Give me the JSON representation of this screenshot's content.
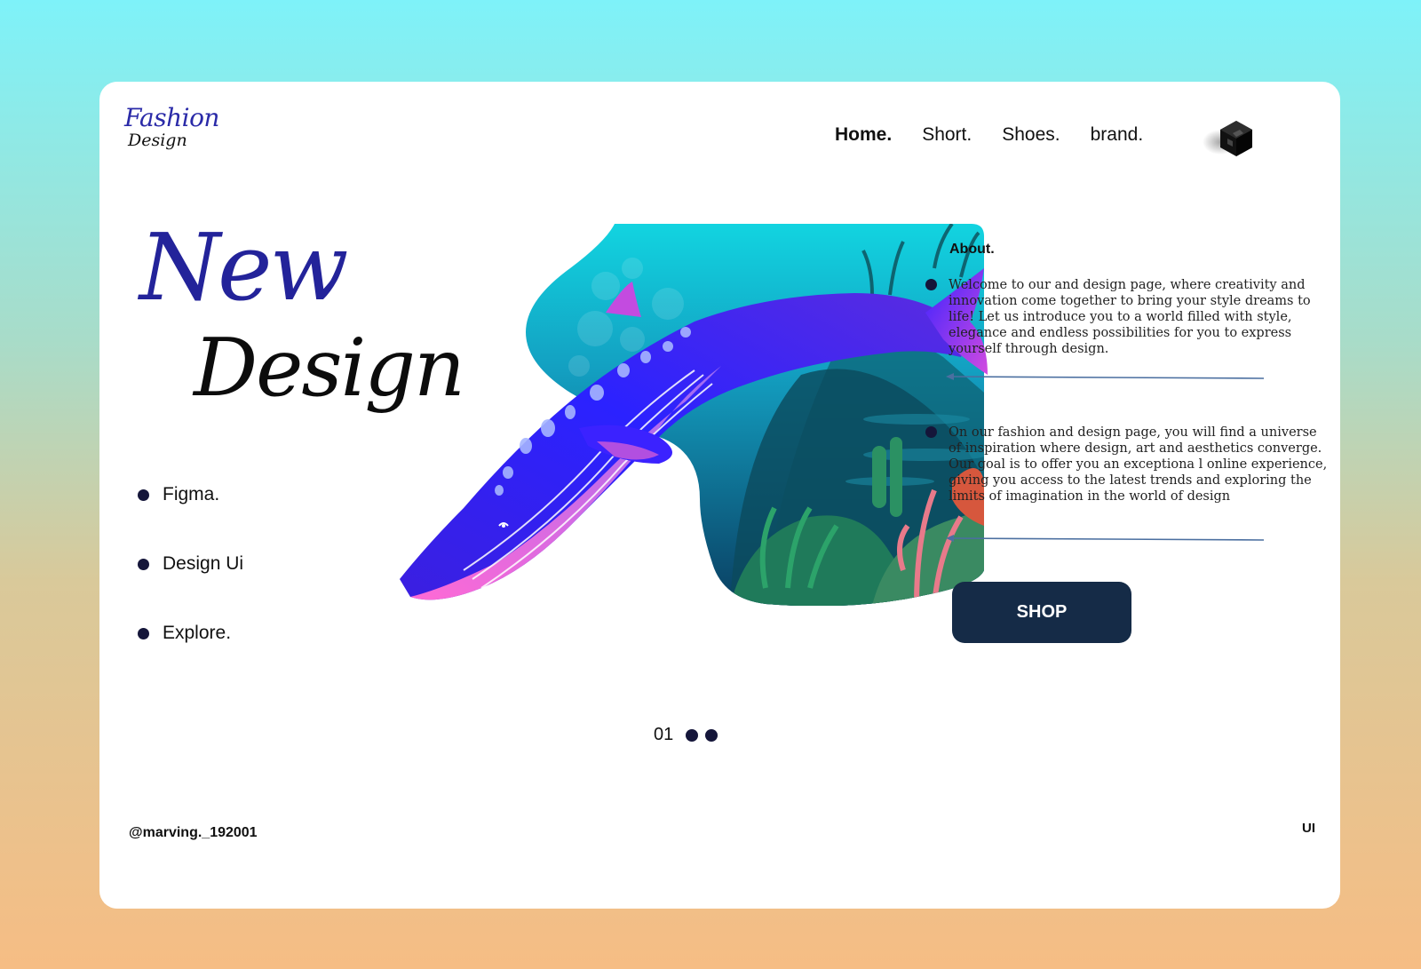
{
  "logo": {
    "line1": "Fashion",
    "line2": "Design"
  },
  "nav": {
    "items": [
      {
        "label": "Home.",
        "active": true
      },
      {
        "label": "Short.",
        "active": false
      },
      {
        "label": "Shoes.",
        "active": false
      },
      {
        "label": "brand.",
        "active": false
      }
    ],
    "profile_icon": "cube-logo-icon"
  },
  "headline": {
    "line1": "New",
    "line2": "Design"
  },
  "features": [
    {
      "label": "Figma."
    },
    {
      "label": "Design Ui"
    },
    {
      "label": "Explore."
    }
  ],
  "hero": {
    "image": "whale-underwater-illustration"
  },
  "about": {
    "title": "About.",
    "paragraphs": [
      "Welcome to our and design page, where creativity and innovation come together to bring your style dreams to life! Let us introduce you to a world filled with style, elegance and endless possibilities for you to express yourself through design.",
      "On our fashion and design page, you will find a universe of inspiration where design, art and aesthetics converge. Our goal is to offer you an exceptiona l online experience, giving you access to the latest trends and exploring the limits of imagination in the world of design"
    ]
  },
  "shop_button": {
    "label": "SHOP"
  },
  "pager": {
    "current": "01"
  },
  "footer": {
    "handle": "@marving._192001",
    "tag": "UI"
  },
  "colors": {
    "accent_blue": "#23239a",
    "button_navy": "#152b47",
    "bullet": "#15163a"
  }
}
